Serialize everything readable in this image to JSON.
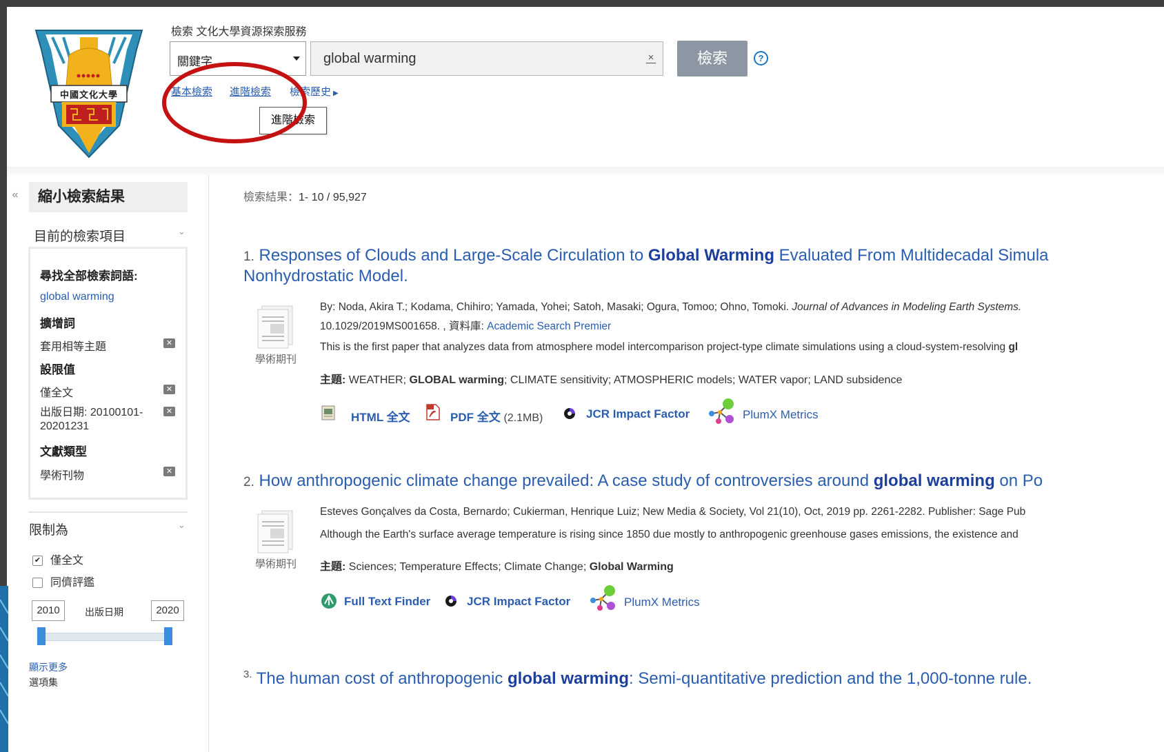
{
  "header": {
    "service_label": "檢索 文化大學資源探索服務",
    "field_select": "關鍵字",
    "search_value": "global warming",
    "search_button": "檢索",
    "help": "?",
    "links": {
      "basic": "基本檢索",
      "advanced": "進階檢索",
      "history": "檢索歷史"
    },
    "tooltip": "進階檢索",
    "logo_text": "中國文化大學"
  },
  "sidebar": {
    "collapse": "«",
    "title": "縮小檢索結果",
    "current_section": "目前的檢索項目",
    "find_all_label": "尋找全部檢索詞語:",
    "query_link": "global warming",
    "expanders_label": "擴增詞",
    "expander_item": "套用相等主題",
    "limiters_label": "設限值",
    "limiter_fulltext": "僅全文",
    "limiter_date": "出版日期: 20100101-20201231",
    "doctype_label": "文獻類型",
    "doctype_item": "學術刊物",
    "limit_section": "限制為",
    "cb_fulltext": "僅全文",
    "cb_peer": "同儕評鑑",
    "year_from": "2010",
    "year_label": "出版日期",
    "year_to": "2020",
    "show_more": "顯示更多",
    "options": "選項集"
  },
  "results": {
    "count_label": "檢索結果：",
    "count_value": "1- 10 / 95,927",
    "items": [
      {
        "num": "1.",
        "title_a": "Responses of Clouds and Large-Scale Circulation to ",
        "title_b": "Global Warming",
        "title_c": " Evaluated From Multidecadal Simula",
        "title_d": "Nonhydrostatic Model.",
        "authors": "By: Noda, Akira T.; Kodama, Chihiro; Yamada, Yohei; Satoh, Masaki; Ogura, Tomoo; Ohno, Tomoki. ",
        "journal": "Journal of Advances in Modeling Earth Systems.",
        "doi": "10.1029/2019MS001658. , 資料庫: ",
        "database": "Academic Search Premier",
        "abstract_a": "This is the first paper that analyzes data from atmosphere model intercomparison project-type climate simulations using a cloud-system-resolving ",
        "abstract_b": "gl",
        "subject_label": "主題:",
        "subject_a": " WEATHER; ",
        "subject_b": "GLOBAL warming",
        "subject_c": "; CLIMATE sensitivity; ATMOSPHERIC models; WATER vapor; LAND subsidence",
        "type": "學術期刊",
        "html_ft": "HTML 全文",
        "pdf_ft": "PDF 全文",
        "pdf_size": "(2.1MB)",
        "jcr": "JCR Impact Factor",
        "plumx": "PlumX Metrics"
      },
      {
        "num": "2.",
        "title_a": "How anthropogenic climate change prevailed: A case study of controversies around ",
        "title_b": "global warming",
        "title_c": " on Po",
        "source": "Esteves Gonçalves da Costa, Bernardo; Cukierman, Henrique Luiz; New Media & Society, Vol 21(10), Oct, 2019 pp. 2261-2282. Publisher: Sage Pub",
        "abstract": "Although the Earth's surface average temperature is rising since 1850 due mostly to anthropogenic greenhouse gases emissions, the existence and",
        "subject_label": "主題:",
        "subject_a": " Sciences; Temperature Effects; Climate Change; ",
        "subject_b": "Global Warming",
        "type": "學術期刊",
        "fulltext_finder": "Full Text Finder",
        "jcr": "JCR Impact Factor",
        "plumx": "PlumX Metrics"
      },
      {
        "num": "3.",
        "title_a": "The human cost of anthropogenic ",
        "title_b": "global warming",
        "title_c": ": Semi-quantitative prediction and the 1,000-tonne rule."
      }
    ]
  }
}
